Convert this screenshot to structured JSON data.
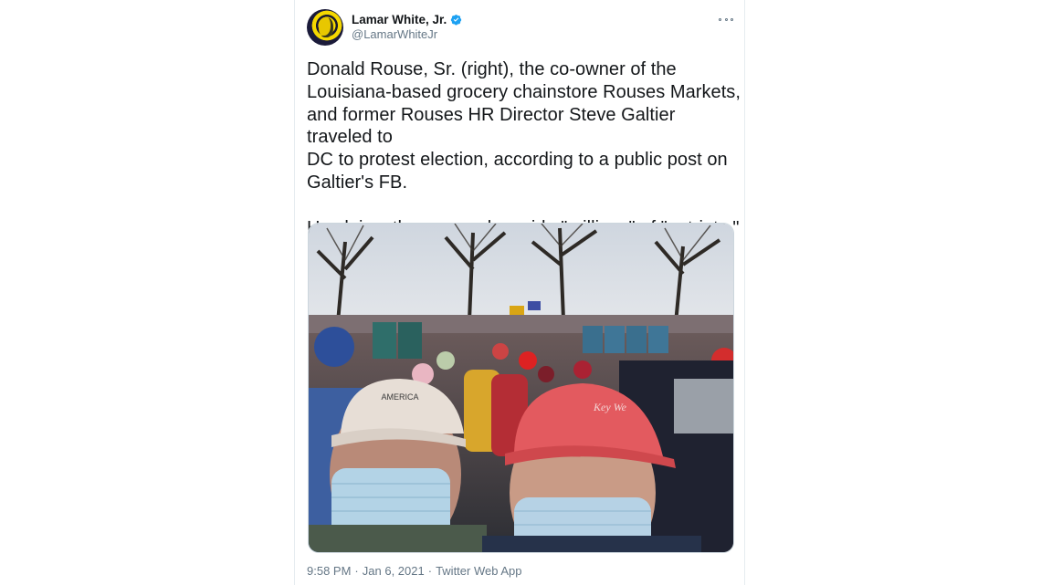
{
  "tweet": {
    "author": {
      "display_name": "Lamar White, Jr.",
      "handle": "@LamarWhiteJr",
      "verified": true
    },
    "text_paragraphs": [
      "Donald Rouse, Sr. (right), the co-owner of the\nLouisiana-based grocery chainstore Rouses Markets,\nand former Rouses HR Director Steve Galtier traveled to\nDC to protest election, according to a public post on\nGaltier's FB.",
      "He claims they were alongside \"millions\" of \"patriots.\""
    ],
    "time": "9:58 PM",
    "separator": "·",
    "date": "Jan 6, 2021",
    "source": "Twitter Web App",
    "photo_caption_text": {
      "left_cap_print": "AMERICA",
      "right_cap_print": "Key We"
    }
  },
  "colors": {
    "text_primary": "#14171a",
    "text_secondary": "#657786",
    "verified_blue": "#1da1f2",
    "border": "#e6ecf0"
  },
  "icons": {
    "verified": "verified-badge-icon",
    "more": "more-options-icon"
  }
}
